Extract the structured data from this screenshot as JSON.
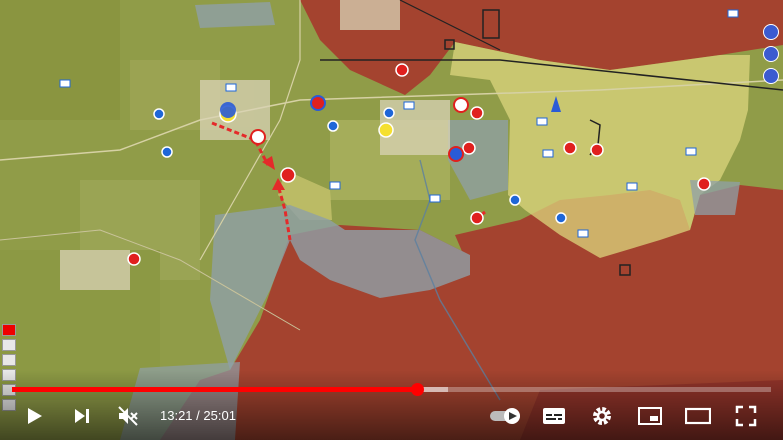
{
  "player": {
    "time_current": "13:21",
    "time_separator": " / ",
    "time_duration": "25:01",
    "progress_fraction": 0.534,
    "buffer_fraction": 0.575,
    "autoplay_enabled": true
  },
  "colors": {
    "played": "#ff0000",
    "occupied_zone": "#a8342c",
    "contested_zone": "#d8d07a",
    "grey_zone": "#8fa0a8",
    "terrain": "#8f9a4a"
  },
  "icons": {
    "play": "play-icon",
    "next": "next-icon",
    "mute": "muted-icon",
    "autoplay": "autoplay-toggle-icon",
    "subtitles": "subtitles-icon",
    "settings": "gear-icon",
    "miniplayer": "miniplayer-icon",
    "theater": "theater-icon",
    "fullscreen": "fullscreen-icon"
  }
}
